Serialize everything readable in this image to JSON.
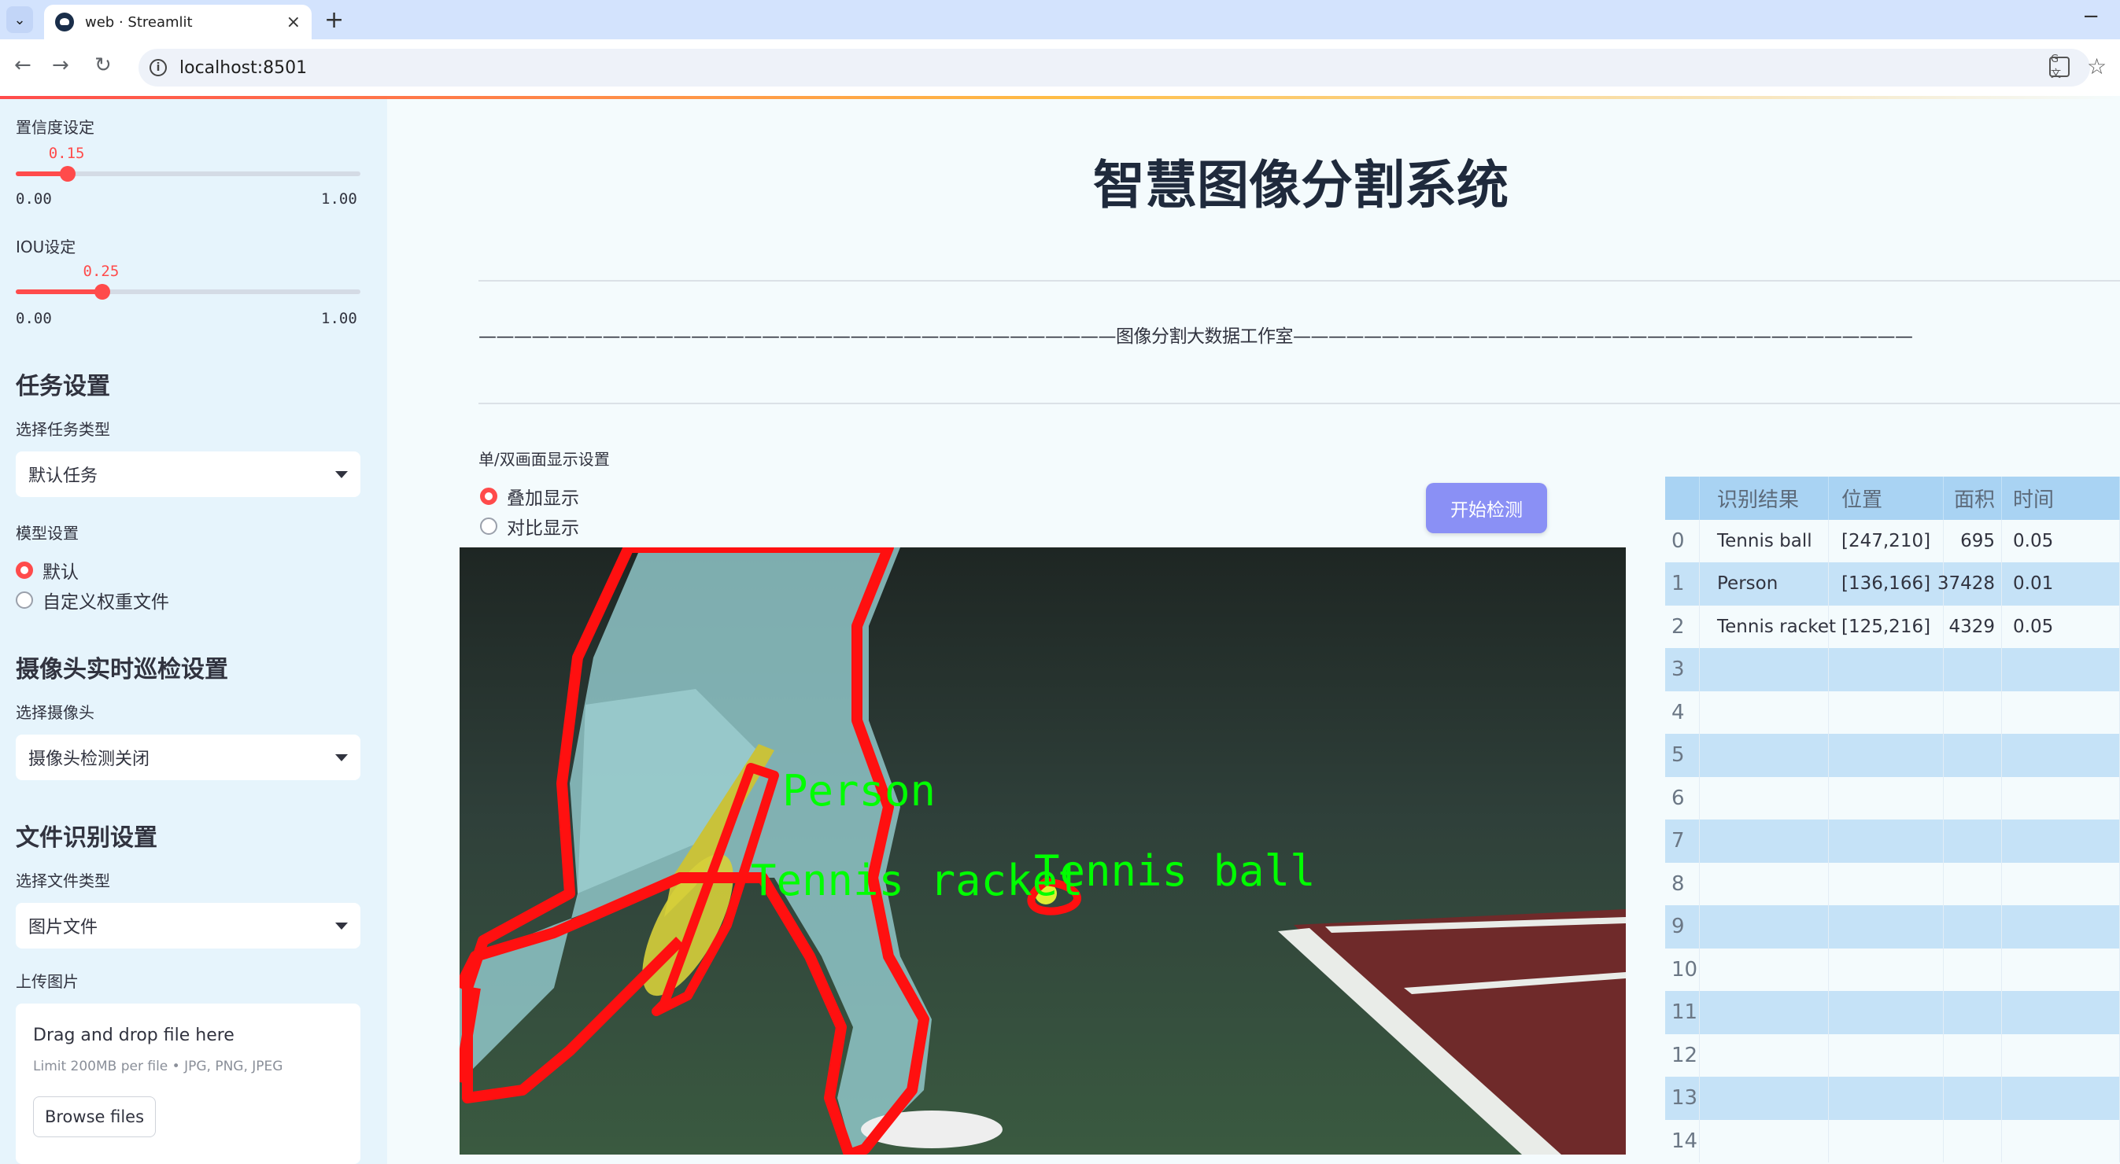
{
  "browser": {
    "tab_title": "web · Streamlit",
    "new_tab": "+",
    "minimize": "−",
    "url": "localhost:8501"
  },
  "sidebar": {
    "confidence_label": "置信度设定",
    "confidence_value": "0.15",
    "confidence_fraction": 0.15,
    "confidence_min": "0.00",
    "confidence_max": "1.00",
    "iou_label": "IOU设定",
    "iou_value": "0.25",
    "iou_fraction": 0.25,
    "iou_min": "0.00",
    "iou_max": "1.00",
    "task_header": "任务设置",
    "task_type_label": "选择任务类型",
    "task_type_value": "默认任务",
    "model_label": "模型设置",
    "model_options": [
      "默认",
      "自定义权重文件"
    ],
    "model_selected": 0,
    "camera_header": "摄像头实时巡检设置",
    "camera_label": "选择摄像头",
    "camera_value": "摄像头检测关闭",
    "file_header": "文件识别设置",
    "file_type_label": "选择文件类型",
    "file_type_value": "图片文件",
    "upload_label": "上传图片",
    "drop_title": "Drag and drop file here",
    "drop_limit": "Limit 200MB per file • JPG, PNG, JPEG",
    "browse_label": "Browse files"
  },
  "main": {
    "title": "智慧图像分割系统",
    "divider_text": "————————————————————————————————————图像分割大数据工作室———————————————————————————————————",
    "display_label": "单/双画面显示设置",
    "display_options": [
      "叠加显示",
      "对比显示"
    ],
    "display_selected": 0,
    "start_button": "开始检测"
  },
  "image_labels": {
    "person": "Person",
    "racket": "Tennis racket",
    "ball": "Tennis ball"
  },
  "table": {
    "headers": [
      "识别结果",
      "位置",
      "面积",
      "时间"
    ],
    "rows": [
      {
        "idx": "0",
        "result": "Tennis ball",
        "pos": "[247,210]",
        "area": "695",
        "time": "0.05"
      },
      {
        "idx": "1",
        "result": "Person",
        "pos": "[136,166]",
        "area": "37428",
        "time": "0.01"
      },
      {
        "idx": "2",
        "result": "Tennis racket",
        "pos": "[125,216]",
        "area": "4329",
        "time": "0.05"
      },
      {
        "idx": "3",
        "result": "",
        "pos": "",
        "area": "",
        "time": ""
      },
      {
        "idx": "4",
        "result": "",
        "pos": "",
        "area": "",
        "time": ""
      },
      {
        "idx": "5",
        "result": "",
        "pos": "",
        "area": "",
        "time": ""
      },
      {
        "idx": "6",
        "result": "",
        "pos": "",
        "area": "",
        "time": ""
      },
      {
        "idx": "7",
        "result": "",
        "pos": "",
        "area": "",
        "time": ""
      },
      {
        "idx": "8",
        "result": "",
        "pos": "",
        "area": "",
        "time": ""
      },
      {
        "idx": "9",
        "result": "",
        "pos": "",
        "area": "",
        "time": ""
      },
      {
        "idx": "10",
        "result": "",
        "pos": "",
        "area": "",
        "time": ""
      },
      {
        "idx": "11",
        "result": "",
        "pos": "",
        "area": "",
        "time": ""
      },
      {
        "idx": "12",
        "result": "",
        "pos": "",
        "area": "",
        "time": ""
      },
      {
        "idx": "13",
        "result": "",
        "pos": "",
        "area": "",
        "time": ""
      },
      {
        "idx": "14",
        "result": "",
        "pos": "",
        "area": "",
        "time": ""
      }
    ]
  },
  "colors": {
    "accent": "#ff4b4b",
    "button": "#8a90f5",
    "sidebar_bg": "#e6f4fc",
    "mask_outline": "#ff0000",
    "label_green": "#00ff00"
  }
}
